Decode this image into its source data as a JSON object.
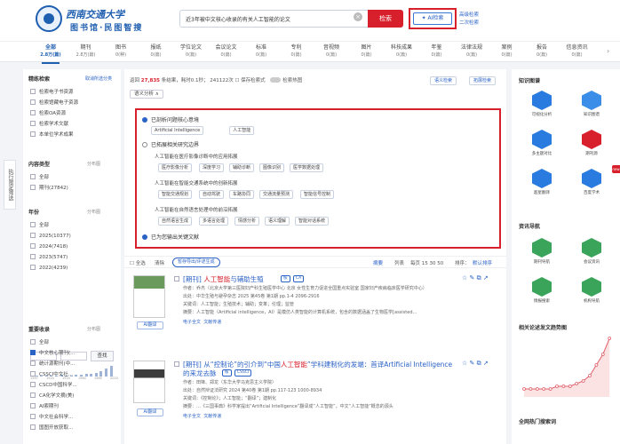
{
  "brand": {
    "name_cn": "西南交通大学",
    "subtitle": "图书馆·民图智搜"
  },
  "search": {
    "value": "近3年被中文核心收录的有关人工智能的论文",
    "button": "检索",
    "ai_button": "AI检索",
    "advanced": "高级检索",
    "second": "二次检索"
  },
  "tabs": [
    {
      "label": "全部",
      "count": "2.8万(篇)"
    },
    {
      "label": "期刊",
      "count": "2.8万(篇)"
    },
    {
      "label": "图书",
      "count": "0(种)"
    },
    {
      "label": "报纸",
      "count": "0(篇)"
    },
    {
      "label": "学位论文",
      "count": "0(篇)"
    },
    {
      "label": "会议论文",
      "count": "0(篇)"
    },
    {
      "label": "标准",
      "count": "0(篇)"
    },
    {
      "label": "专利",
      "count": "0(篇)"
    },
    {
      "label": "音视频",
      "count": "0(篇)"
    },
    {
      "label": "图片",
      "count": "0(篇)"
    },
    {
      "label": "科技成果",
      "count": "0(篇)"
    },
    {
      "label": "年鉴",
      "count": "0(篇)"
    },
    {
      "label": "法律法规",
      "count": "0(篇)"
    },
    {
      "label": "案例",
      "count": "0(篇)"
    },
    {
      "label": "报告",
      "count": "0(篇)"
    },
    {
      "label": "信息资讯",
      "count": "0(篇)"
    }
  ],
  "side_tab": "执行限定筛选",
  "left": {
    "precise_title": "精练检索",
    "precise_link": "取消所选分类",
    "precise_opts": [
      "检索电子书资源",
      "检索馆藏电子资源",
      "检索OA资源",
      "检索学术文献",
      "本单位学术成果"
    ],
    "content_title": "内容类型",
    "content_sort": "分布图",
    "content_opts": [
      "全部",
      "期刊(27842)"
    ],
    "year_title": "年份",
    "year_sort": "分布图",
    "year_opts": [
      "全部",
      "2025(10377)",
      "2024(7418)",
      "2023(5747)",
      "2022(4239)"
    ],
    "year_from": "",
    "year_to": "",
    "year_btn": "查找",
    "hist_axis": [
      "1997",
      "1920",
      "1933",
      "1960",
      "1985",
      "2020"
    ],
    "hist_values": [
      1,
      1,
      1,
      1,
      1,
      1,
      2,
      1,
      1,
      2,
      2,
      3,
      3,
      4,
      6,
      9,
      12
    ],
    "core_title": "重要收录",
    "core_sort": "分布图",
    "core_opts": [
      "全部",
      "中文核心期刊(...",
      "统计源期刊(中...",
      "CSSCI中文社...",
      "CSCD中国科学...",
      "CA化学文摘(美)",
      "AI索期刊",
      "中文社会科学...",
      "国图开放获取..."
    ]
  },
  "main": {
    "summary_pre": "返回 ",
    "summary_count": "27,835",
    "summary_mid": " 条结果，耗时0.1秒；  241122次",
    "save": "保存检索式",
    "toggle_label": "检索热图",
    "view_btn1": "语义检索",
    "view_btn2": "拓展检索",
    "dropdown": "语义分析 ∧",
    "box": {
      "sec1": "已剖析问题核心意境",
      "sec1_pills": [
        "Artificial Intelligence",
        "人工智能"
      ],
      "sec2": "已拓展相关研究边界",
      "sub1": "人工智能在医疗影像诊断中的应用拓展",
      "sub1_pills": [
        "医疗影像分析",
        "深度学习",
        "辅助诊断",
        "图像识别",
        "医学数据处理"
      ],
      "sub2": "人工智能在智能交通系统中的创新拓展",
      "sub2_pills": [
        "智能交通规划",
        "自动驾驶",
        "车路协同",
        "交通流量预测",
        "智能信号控制"
      ],
      "sub3": "人工智能在自然语言处理中的前沿拓展",
      "sub3_pills": [
        "自然语言生成",
        "多语言处理",
        "情感分析",
        "语义理解",
        "智能对话系统"
      ],
      "sec3": "已为您输出关键文献"
    },
    "bar": {
      "select_all": "全选",
      "clear": "清除",
      "bulk": "暂存导出/评述生成",
      "sort_label": "摘要",
      "list_label": "列表",
      "per_page": "每页 15 30 50",
      "sort": "排序：",
      "sort_value": "默认排序"
    },
    "results": [
      {
        "type": "[期刊]",
        "title_hl": "人工智能",
        "title_rest": "与辅助生殖",
        "tags": [
          "核",
          "CA"
        ],
        "ai": "AI翻译",
        "line1": "作者：乔杰（北京大学第三医院妇产科生殖医学中心 北京 女性生育力促进全国重点实验室 国家妇产疾病临床医学研究中心）",
        "line2": "出处：中华生殖与避孕杂志 2025 第45卷 第1期 pp.1-4 2096-2916",
        "line3": "关键词：人工智能；生殖技术；辅助；变革；伦理；监管",
        "line4": "摘要：人工智能（Artificial intelligence，AI）是模仿人类智能的计算机系统，包含的数据涵盖了生物医学[assisted…",
        "links": [
          "电子全文",
          "文献传递"
        ]
      },
      {
        "type": "[期刊]",
        "title_pre": "从“控制论”的引介到“中国",
        "title_hl": "人工智能",
        "title_rest": "”学科建制化的发端：",
        "title_line2": "的来龙去脉",
        "title_en": "首译Artificial Intelligence",
        "tags": [
          "核",
          "CSSCI"
        ],
        "ai": "AI翻译",
        "line1": "作者：田锋、郑龙（东华大学马克思主义学院）",
        "line2": "出处：自然辩证法研究 2024 第40卷 第1期 pp.117-123 1000-8934",
        "line3": "关键词：《控制论》；人工智能；“翻译”；建制化",
        "line4": "摘要：…《三国事典》科学家提出“Artificial Intelligence”翻译成“人工智能”，中文“人工智能”概念的源头",
        "links": [
          "电子全文",
          "文献传递"
        ]
      }
    ]
  },
  "right": {
    "kg_title": "知识图谱",
    "tiles": [
      {
        "label": "可视化分析",
        "color": "#2a7be0"
      },
      {
        "label": "知识图谱",
        "color": "#3a8ee8"
      },
      {
        "label": "多主题对比",
        "color": "#2a7be0"
      },
      {
        "label": "期刊源",
        "color": "#d8202c"
      },
      {
        "label": "超星翻译",
        "color": "#2a7be0"
      },
      {
        "label": "百度学术",
        "color": "#2a7be0"
      }
    ],
    "nav_title": "资讯导航",
    "nav_tiles": [
      {
        "label": "期刊导航",
        "color": "#3aa55a"
      },
      {
        "label": "会议资讯",
        "color": "#3aa55a"
      },
      {
        "label": "情报搜索",
        "color": "#3aa55a"
      },
      {
        "label": "机构导航",
        "color": "#3aa55a"
      }
    ],
    "trend_title": "相关论述发文趋势图",
    "trend_values": [
      3,
      3,
      3,
      3,
      3,
      4,
      4,
      4,
      5,
      6,
      8,
      12,
      16,
      22
    ],
    "hot_title": "全网热门搜索词"
  },
  "badge": "new"
}
